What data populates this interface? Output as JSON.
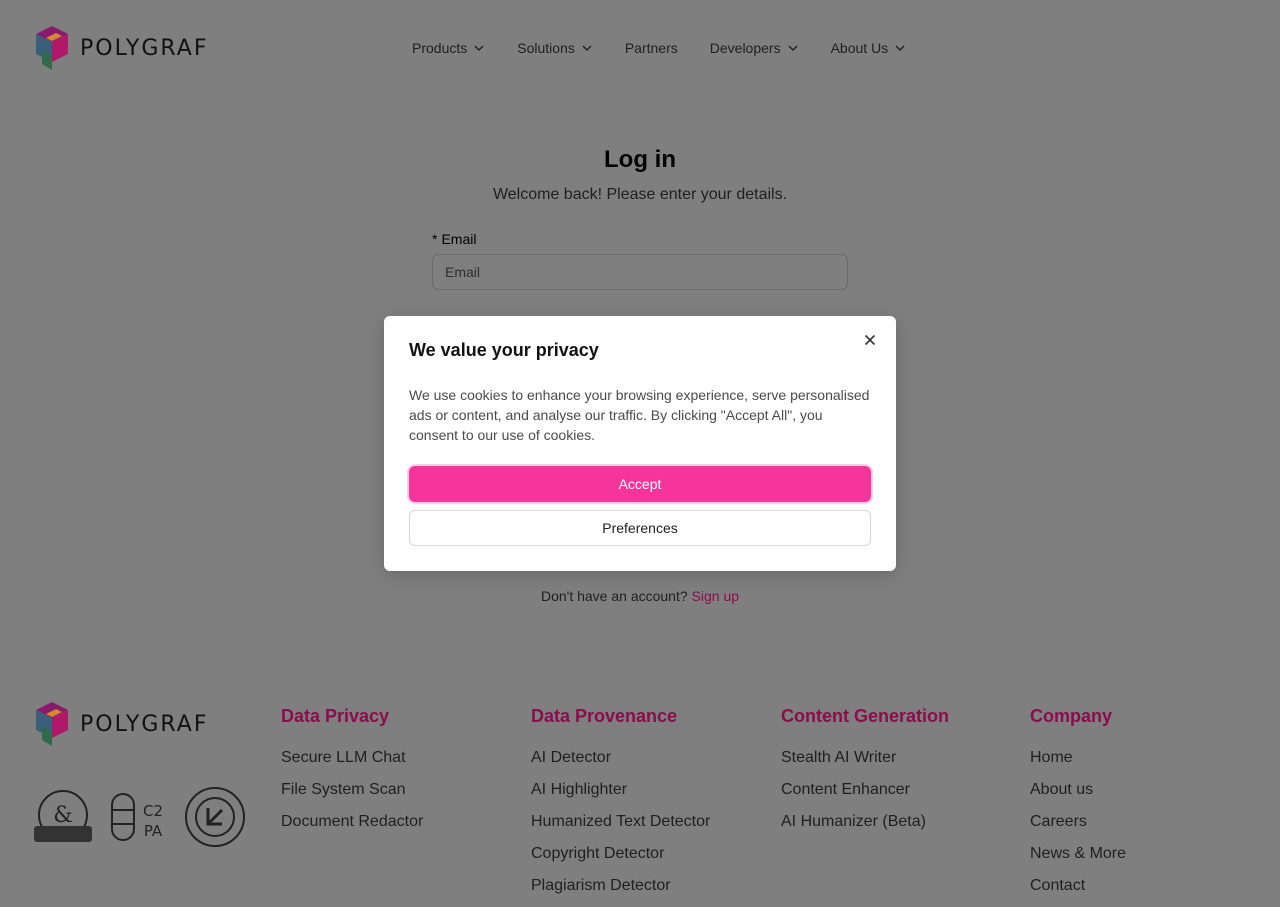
{
  "brand": {
    "name": "POLYGRAF"
  },
  "nav": [
    {
      "label": "Products",
      "has_dropdown": true
    },
    {
      "label": "Solutions",
      "has_dropdown": true
    },
    {
      "label": "Partners",
      "has_dropdown": false
    },
    {
      "label": "Developers",
      "has_dropdown": true
    },
    {
      "label": "About Us",
      "has_dropdown": true
    }
  ],
  "login": {
    "title": "Log in",
    "subtitle": "Welcome back! Please enter your details.",
    "email_required_mark": "*",
    "email_label": "Email",
    "email_placeholder": "Email",
    "signup_prompt": "Don't have an account?",
    "signup_link": "Sign up"
  },
  "cookie_modal": {
    "title": "We value your privacy",
    "body": "We use cookies to enhance your browsing experience, serve personalised ads or content, and analyse our traffic. By clicking \"Accept All\", you consent to our use of cookies.",
    "accept_label": "Accept",
    "preferences_label": "Preferences"
  },
  "footer": {
    "badges": [
      "dun-bradstreet-badge",
      "c2pa-badge",
      "sxsw-pitch-badge"
    ],
    "columns": [
      {
        "title": "Data Privacy",
        "items": [
          "Secure LLM Chat",
          "File System Scan",
          "Document Redactor"
        ]
      },
      {
        "title": "Data Provenance",
        "items": [
          "AI Detector",
          "AI Highlighter",
          "Humanized Text Detector",
          "Copyright Detector",
          "Plagiarism Detector"
        ]
      },
      {
        "title": "Content Generation",
        "items": [
          "Stealth AI Writer",
          "Content Enhancer",
          "AI Humanizer (Beta)"
        ]
      },
      {
        "title": "Company",
        "items": [
          "Home",
          "About us",
          "Careers",
          "News & More",
          "Contact"
        ]
      }
    ]
  },
  "colors": {
    "overlay": "#7f7f7f",
    "accent_pink": "#f7349c",
    "footer_heading": "#8a0d4d",
    "link": "#8a0d4d"
  }
}
